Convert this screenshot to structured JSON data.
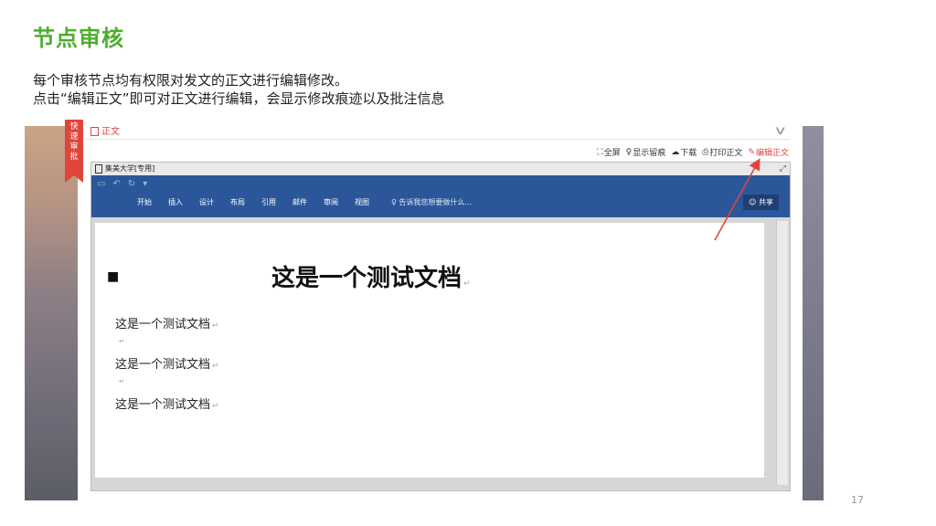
{
  "slide": {
    "title": "节点审核",
    "lines": [
      "每个审核节点均有权限对发文的正文进行编辑修改。",
      "点击“编辑正文”即可对正文进行编辑，会显示修改痕迹以及批注信息"
    ],
    "page_number": "17"
  },
  "side_tag": {
    "line1": "快",
    "line2": "速",
    "line3": "审",
    "line4": "批"
  },
  "panel": {
    "tab_label": "正文",
    "toolbar": {
      "fullscreen": "全屏",
      "show_marks": "显示留痕",
      "download": "下载",
      "print": "打印正文",
      "edit": "编辑正文"
    }
  },
  "document": {
    "window_title": "集美大学[专用]",
    "tabs": [
      "开始",
      "插入",
      "设计",
      "布局",
      "引用",
      "邮件",
      "审阅",
      "视图"
    ],
    "tell_me": "告诉我您想要做什么...",
    "share": "共享",
    "heading": "这是一个测试文档",
    "body_lines": [
      "这是一个测试文档",
      "这是一个测试文档",
      "这是一个测试文档"
    ],
    "paragraph_mark": "↵"
  },
  "colors": {
    "title_green": "#4cae2c",
    "accent_red": "#e0453b",
    "word_blue": "#2b579a"
  }
}
